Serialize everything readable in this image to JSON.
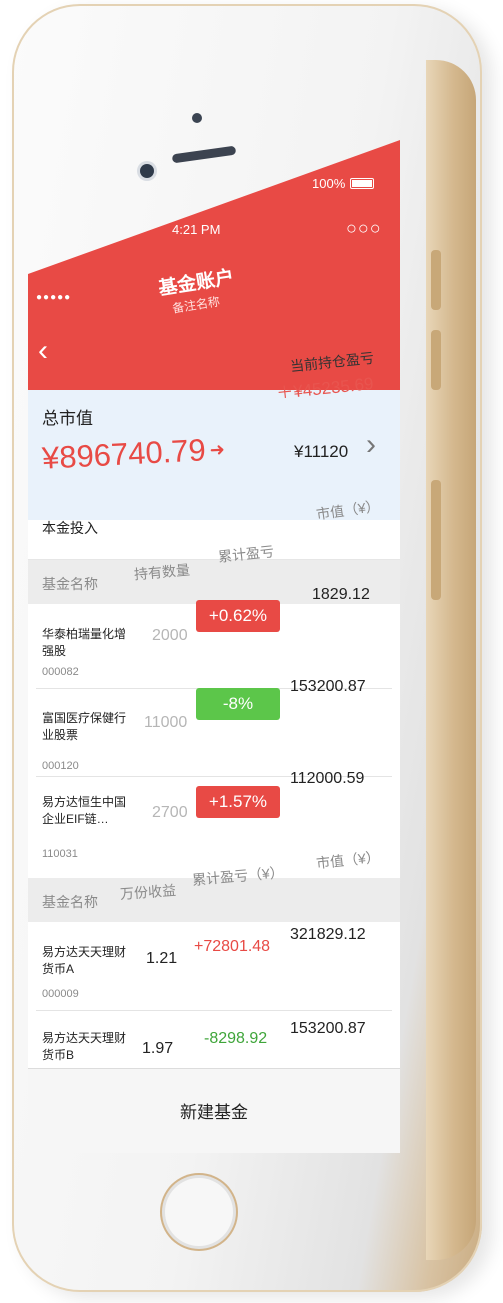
{
  "status_bar": {
    "signal": "●●●●●",
    "time": "4:21 PM",
    "battery": "100%"
  },
  "nav": {
    "back_icon": "chevron-left-icon",
    "title": "基金账户",
    "subtitle": "备注名称",
    "more_icon": "ellipsis-icon"
  },
  "summary": {
    "total_label": "总市值",
    "total_value": "¥896740.79",
    "trend_icon": "arrow-up-icon",
    "hold_pl_label": "当前持仓盈亏",
    "hold_pl_value": "＋¥45235.69",
    "principal_value": "¥11120",
    "principal_label": "本金投入"
  },
  "stock_table": {
    "headers": [
      "基金名称",
      "持有数量",
      "累计盈亏",
      "市值（¥）"
    ],
    "rows": [
      {
        "name": "华泰柏瑞量化增强股",
        "code": "000082",
        "qty": "2000",
        "pl": "+0.62%",
        "pl_sign": "up",
        "value": "1829.12"
      },
      {
        "name": "富国医疗保健行业股票",
        "code": "000120",
        "qty": "11000",
        "pl": "-8%",
        "pl_sign": "down",
        "value": "153200.87"
      },
      {
        "name": "易方达恒生中国企业EIF链…",
        "code": "110031",
        "qty": "2700",
        "pl": "+1.57%",
        "pl_sign": "up",
        "value": "112000.59"
      }
    ]
  },
  "money_table": {
    "headers": [
      "基金名称",
      "万份收益",
      "累计盈亏（¥）",
      "市值（¥）"
    ],
    "rows": [
      {
        "name": "易方达天天理财货币A",
        "code": "000009",
        "earn": "1.21",
        "pl": "+72801.48",
        "pl_sign": "up",
        "value": "321829.12"
      },
      {
        "name": "易方达天天理财货币B",
        "code": "",
        "earn": "1.97",
        "pl": "-8298.92",
        "pl_sign": "down",
        "value": "153200.87"
      }
    ]
  },
  "footer": {
    "new_fund_label": "新建基金"
  },
  "colors": {
    "accent_red": "#e84a45",
    "positive_green": "#5cc64a",
    "summary_bg": "#e9f2fb"
  }
}
